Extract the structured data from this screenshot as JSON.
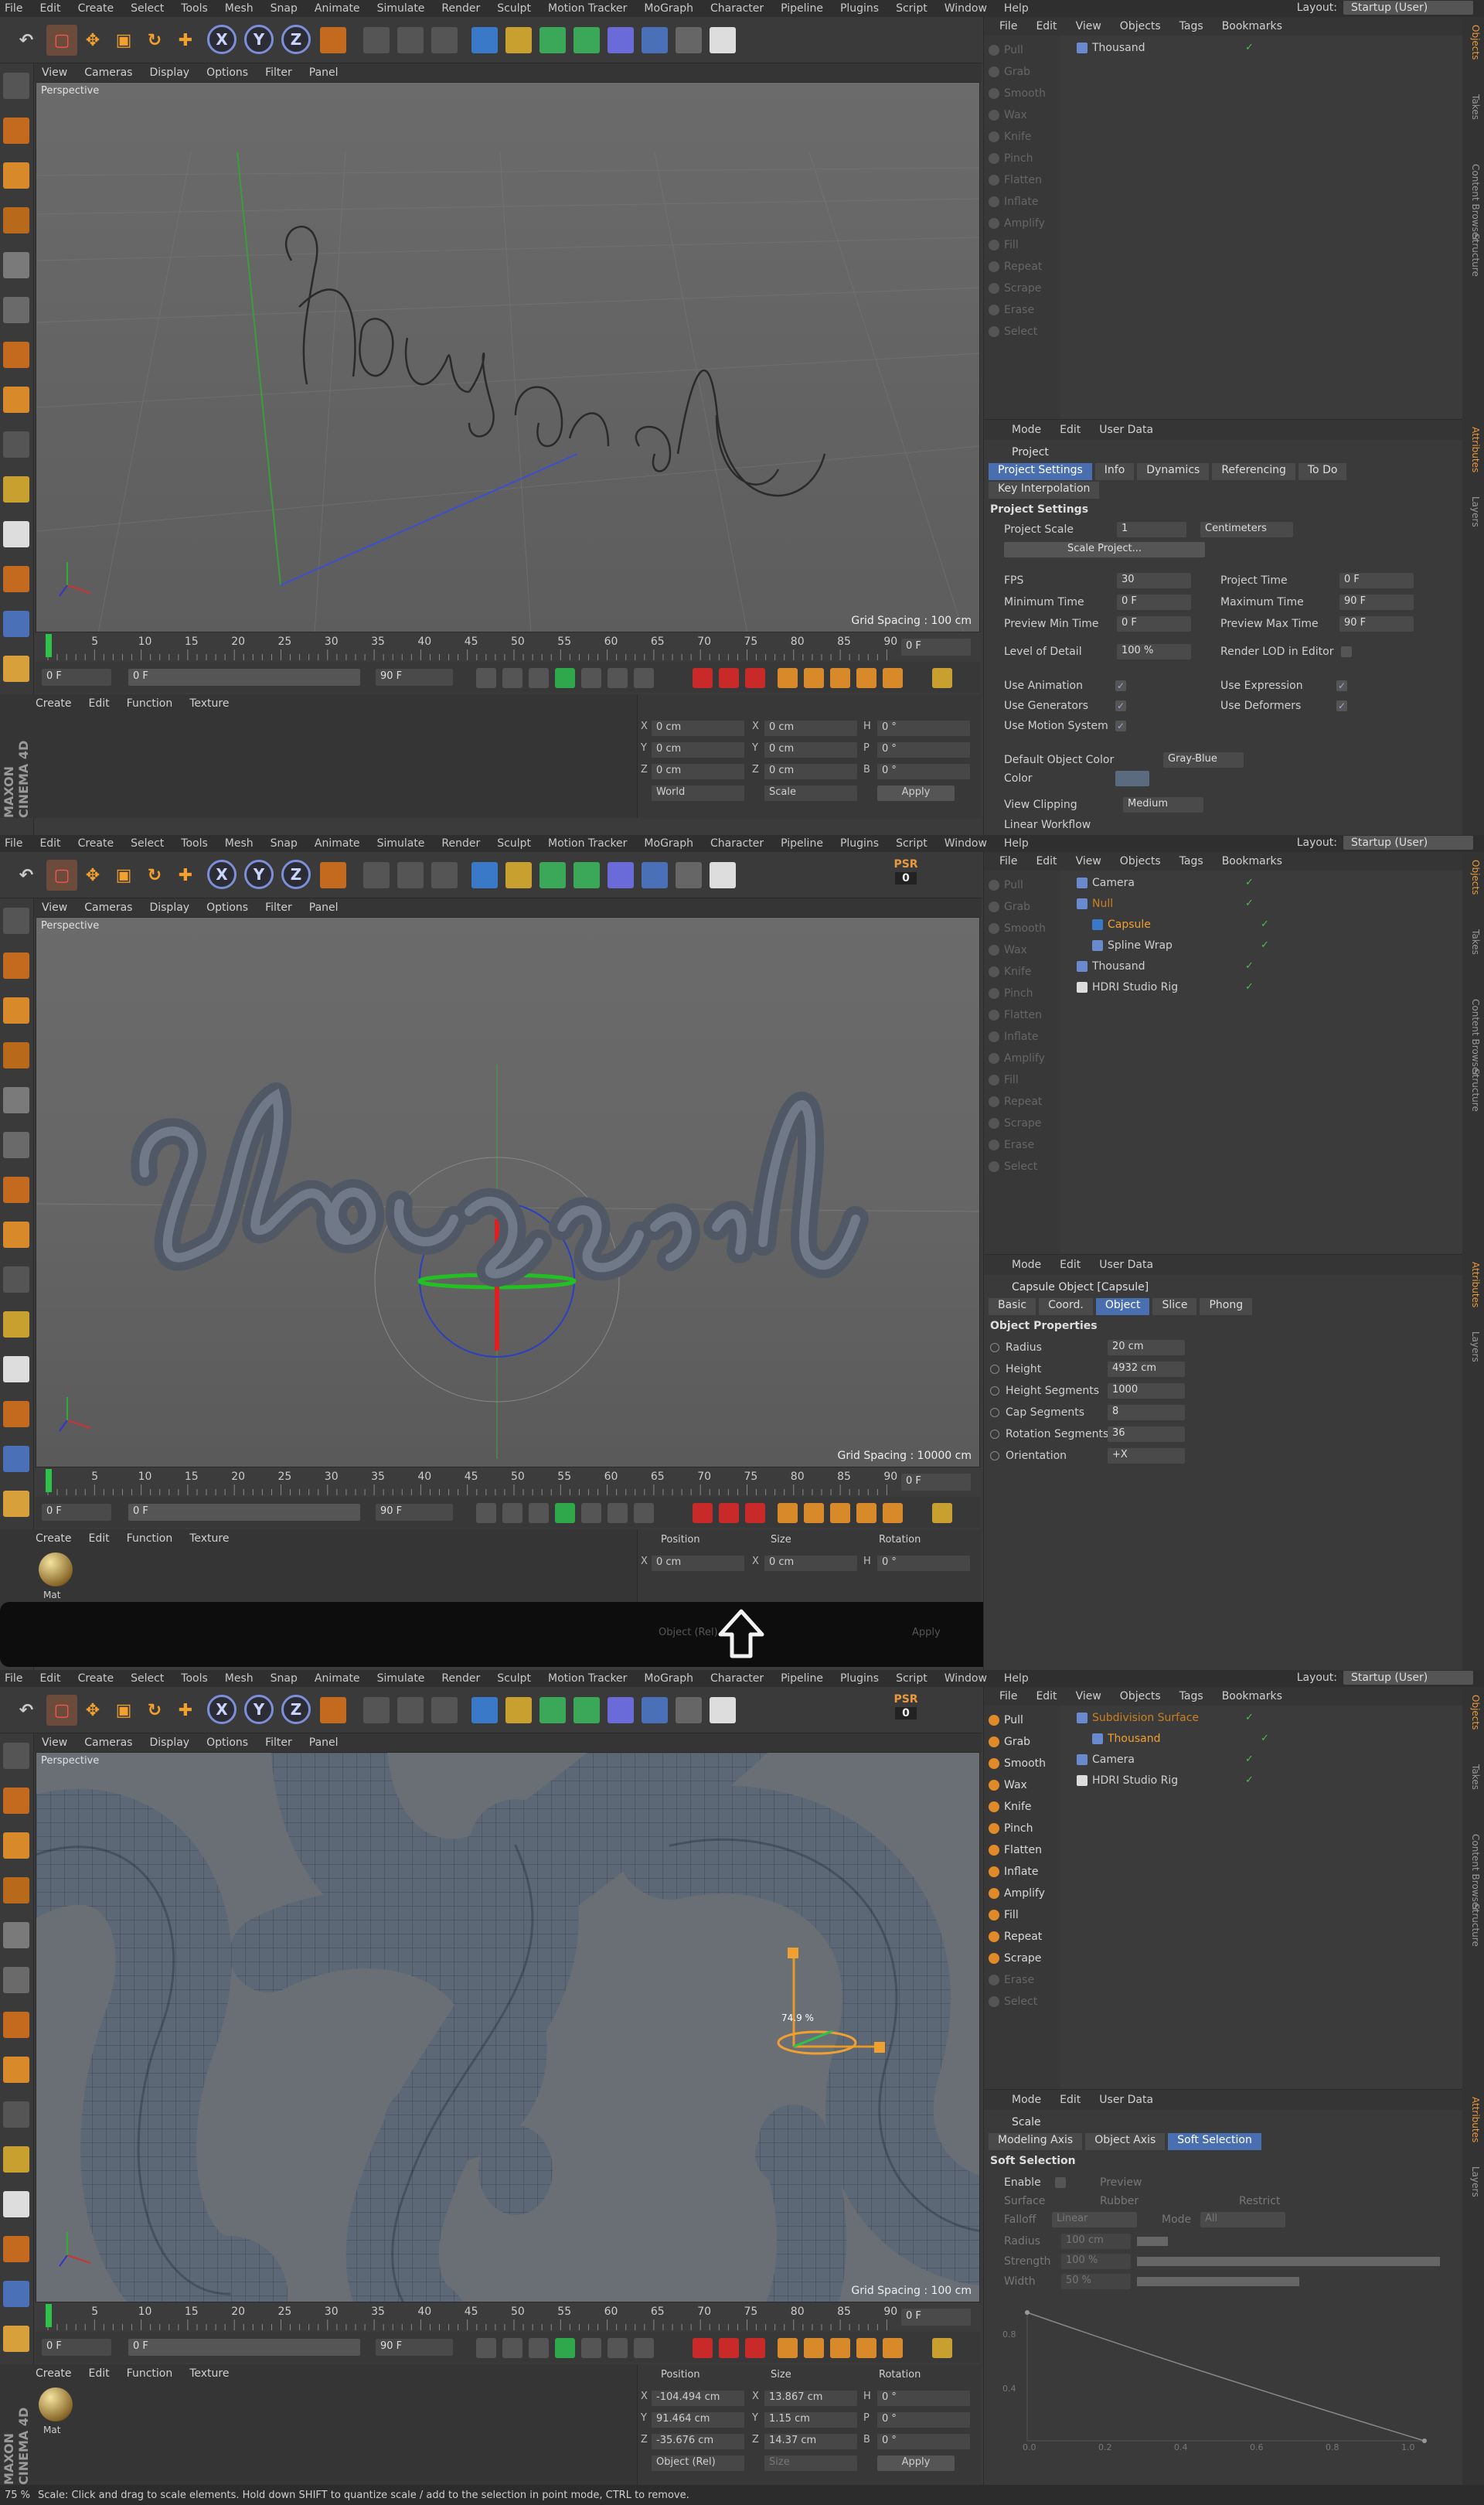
{
  "menu": [
    "File",
    "Edit",
    "Create",
    "Select",
    "Tools",
    "Mesh",
    "Snap",
    "Animate",
    "Simulate",
    "Render",
    "Sculpt",
    "Motion Tracker",
    "MoGraph",
    "Character",
    "Pipeline",
    "Plugins",
    "Script",
    "Window",
    "Help"
  ],
  "layout_label": "Layout:",
  "layout_value": "Startup (User)",
  "viewport_menu": [
    "View",
    "Cameras",
    "Display",
    "Options",
    "Filter",
    "Panel"
  ],
  "viewport_label": "Perspective",
  "material_menu": [
    "Create",
    "Edit",
    "Function",
    "Texture"
  ],
  "object_menu": [
    "File",
    "Edit",
    "View",
    "Objects",
    "Tags",
    "Bookmarks"
  ],
  "attr_menu": [
    "Mode",
    "Edit",
    "User Data"
  ],
  "sculpt_tools": [
    "Pull",
    "Grab",
    "Smooth",
    "Wax",
    "Knife",
    "Pinch",
    "Flatten",
    "Inflate",
    "Amplify",
    "Fill",
    "Repeat",
    "Scrape",
    "Erase",
    "Select"
  ],
  "ruler_ticks": [
    "0",
    "5",
    "10",
    "15",
    "20",
    "25",
    "30",
    "35",
    "40",
    "45",
    "50",
    "55",
    "60",
    "65",
    "70",
    "75",
    "80",
    "85",
    "90"
  ],
  "brand": "MAXON CINEMA 4D",
  "panels": [
    {
      "grid_spacing": "Grid Spacing : 100 cm",
      "frame_end": "0 F",
      "transport_start": "0 F",
      "transport_min": "0 F",
      "transport_max": "90 F",
      "transport_end": "90 F",
      "objects": [
        {
          "name": "Thousand",
          "indent": 0
        }
      ],
      "coords": {
        "x_pos": "0 cm",
        "y_pos": "0 cm",
        "z_pos": "0 cm",
        "x_size": "0 cm",
        "y_size": "0 cm",
        "z_size": "0 cm",
        "h": "0 °",
        "p": "0 °",
        "b": "0 °",
        "mode1": "World",
        "mode2": "Scale",
        "apply": "Apply"
      },
      "attr": {
        "title": "Project",
        "tabs": [
          "Project Settings",
          "Info",
          "Dynamics",
          "Referencing",
          "To Do"
        ],
        "tabs2": [
          "Key Interpolation"
        ],
        "section": "Project Settings",
        "project_scale_label": "Project Scale",
        "project_scale": "1",
        "project_scale_unit": "Centimeters",
        "scale_btn": "Scale Project...",
        "left_fields": [
          {
            "label": "FPS",
            "value": "30"
          },
          {
            "label": "Minimum Time",
            "value": "0 F"
          },
          {
            "label": "Preview Min Time",
            "value": "0 F"
          },
          {
            "label": "Level of Detail",
            "value": "100 %"
          }
        ],
        "right_fields": [
          {
            "label": "Project Time",
            "value": "0 F"
          },
          {
            "label": "Maximum Time",
            "value": "90 F"
          },
          {
            "label": "Preview Max Time",
            "value": "90 F"
          },
          {
            "label": "Render LOD in Editor",
            "value": ""
          }
        ],
        "checks_left": [
          "Use Animation",
          "Use Generators",
          "Use Motion System"
        ],
        "checks_right": [
          "Use Expression",
          "Use Deformers"
        ],
        "doc_label": "Default Object Color",
        "doc_value": "Gray-Blue",
        "color_label": "Color",
        "clip_label": "View Clipping",
        "clip_value": "Medium",
        "linear_label": "Linear Workflow"
      }
    },
    {
      "grid_spacing": "Grid Spacing : 10000 cm",
      "frame_end": "0 F",
      "transport_start": "0 F",
      "transport_min": "0 F",
      "transport_max": "90 F",
      "transport_end": "90 F",
      "psr": "PSR",
      "psr_val": "0",
      "objects": [
        {
          "name": "Camera",
          "indent": 0
        },
        {
          "name": "Null",
          "indent": 0
        },
        {
          "name": "Capsule",
          "indent": 1
        },
        {
          "name": "Spline Wrap",
          "indent": 1
        },
        {
          "name": "Thousand",
          "indent": 0
        },
        {
          "name": "HDRI Studio Rig",
          "indent": 0
        }
      ],
      "coords": {
        "pos_h": "Position",
        "size_h": "Size",
        "rot_h": "Rotation",
        "x_pos": "0 cm",
        "x_size": "0 cm",
        "h": "0 °",
        "mode1": "Object (Rel)",
        "apply": "Apply"
      },
      "attr": {
        "title": "Capsule Object [Capsule]",
        "tabs": [
          "Basic",
          "Coord.",
          "Object",
          "Slice",
          "Phong"
        ],
        "section": "Object Properties",
        "fields": [
          {
            "label": "Radius",
            "value": "20 cm"
          },
          {
            "label": "Height",
            "value": "4932 cm"
          },
          {
            "label": "Height Segments",
            "value": "1000"
          },
          {
            "label": "Cap Segments",
            "value": "8"
          },
          {
            "label": "Rotation Segments",
            "value": "36"
          },
          {
            "label": "Orientation",
            "value": "+X"
          }
        ]
      },
      "material": "Mat"
    },
    {
      "grid_spacing": "Grid Spacing : 100 cm",
      "frame_end": "0 F",
      "transport_start": "0 F",
      "transport_min": "0 F",
      "transport_max": "90 F",
      "transport_end": "90 F",
      "psr": "PSR",
      "psr_val": "0",
      "handle_label": "74.9 %",
      "objects": [
        {
          "name": "Subdivision Surface",
          "indent": 0
        },
        {
          "name": "Thousand",
          "indent": 1
        },
        {
          "name": "Camera",
          "indent": 0
        },
        {
          "name": "HDRI Studio Rig",
          "indent": 0
        }
      ],
      "coords": {
        "pos_h": "Position",
        "size_h": "Size",
        "rot_h": "Rotation",
        "x_pos": "-104.494 cm",
        "y_pos": "91.464 cm",
        "z_pos": "-35.676 cm",
        "x_size": "13.867 cm",
        "y_size": "1.15 cm",
        "z_size": "14.37 cm",
        "h": "0 °",
        "p": "0 °",
        "b": "0 °",
        "mode1": "Object (Rel)",
        "mode2": "Size",
        "apply": "Apply"
      },
      "attr": {
        "title": "Scale",
        "tabs": [
          "Modeling Axis",
          "Object Axis",
          "Soft Selection"
        ],
        "section": "Soft Selection",
        "enable": "Enable",
        "preview": "Preview",
        "surface": "Surface",
        "rubber": "Rubber",
        "restrict": "Restrict",
        "falloff": "Falloff",
        "falloff_val": "Linear",
        "mode": "Mode",
        "mode_val": "All",
        "radius": "Radius",
        "radius_val": "100 cm",
        "strength": "Strength",
        "strength_val": "100 %",
        "width": "Width",
        "width_val": "50 %",
        "graph_y": [
          "0.8",
          "0.4"
        ],
        "graph_x": [
          "0.0",
          "0.2",
          "0.4",
          "0.6",
          "0.8",
          "1.0"
        ]
      },
      "material": "Mat",
      "zoom": "75 %",
      "status": "Scale: Click and drag to scale elements. Hold down SHIFT to quantize scale / add to the selection in point mode, CTRL to remove."
    }
  ],
  "vertical_tabs": [
    "Objects",
    "Takes",
    "Content Browser",
    "Structure"
  ],
  "vertical_tabs2": [
    "Attributes",
    "Layers"
  ]
}
